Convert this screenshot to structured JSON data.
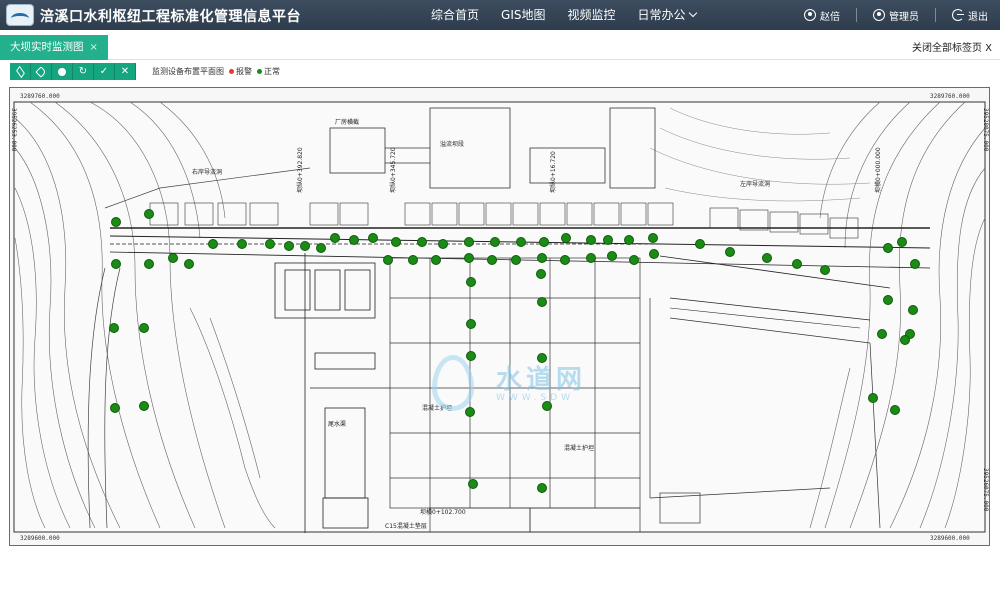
{
  "header": {
    "app_title": "涪溪口水利枢纽工程标准化管理信息平台",
    "nav": [
      {
        "label": "综合首页"
      },
      {
        "label": "GIS地图"
      },
      {
        "label": "视频监控"
      },
      {
        "label": "日常办公"
      }
    ],
    "user": {
      "name": "赵倍",
      "role": "管理员",
      "logout": "退出"
    }
  },
  "tabs": {
    "active_tab": "大坝实时监测图",
    "close_symbol": "×",
    "close_all": "关闭全部标签页 X"
  },
  "toolbar": {
    "buttons": [
      {
        "name": "layers-icon"
      },
      {
        "name": "tag-icon"
      },
      {
        "name": "circle-icon"
      },
      {
        "name": "refresh-icon",
        "glyph": "↻"
      },
      {
        "name": "check-icon",
        "glyph": "✓"
      },
      {
        "name": "close-icon",
        "glyph": "✕"
      }
    ],
    "legend_title": "监测设备布置平面图",
    "legend_alarm": "报警",
    "legend_normal": "正常",
    "alarm_color": "#e53935",
    "normal_color": "#1c8a16"
  },
  "drawing": {
    "coords": {
      "tl_h": "3289760.000",
      "tl_v": "39526253.000",
      "tr_h": "3289760.000",
      "tr_v": "39528075.000",
      "bl_h": "3289600.000",
      "br_h": "3289600.000",
      "br_v": "39526075.000"
    },
    "labels": {
      "plant": "厂房横截",
      "spillway": "溢流坝段",
      "tail": "尾水渠",
      "concrete1": "混凝土护坦",
      "concrete2": "混凝土护坦",
      "apron": "C15混凝土垫层",
      "station1": "坝横0+102.700",
      "elev1": "坝纵0+392.820",
      "elev2": "坝纵0+345.720",
      "elev3": "坝纵0+16.720",
      "elev4": "坝横0+000.000",
      "left_tunnel": "左岸导流洞",
      "right_tunnel": "右岸导流洞"
    }
  },
  "watermark": {
    "text": "水道网",
    "sub": "WWW.SDW"
  }
}
